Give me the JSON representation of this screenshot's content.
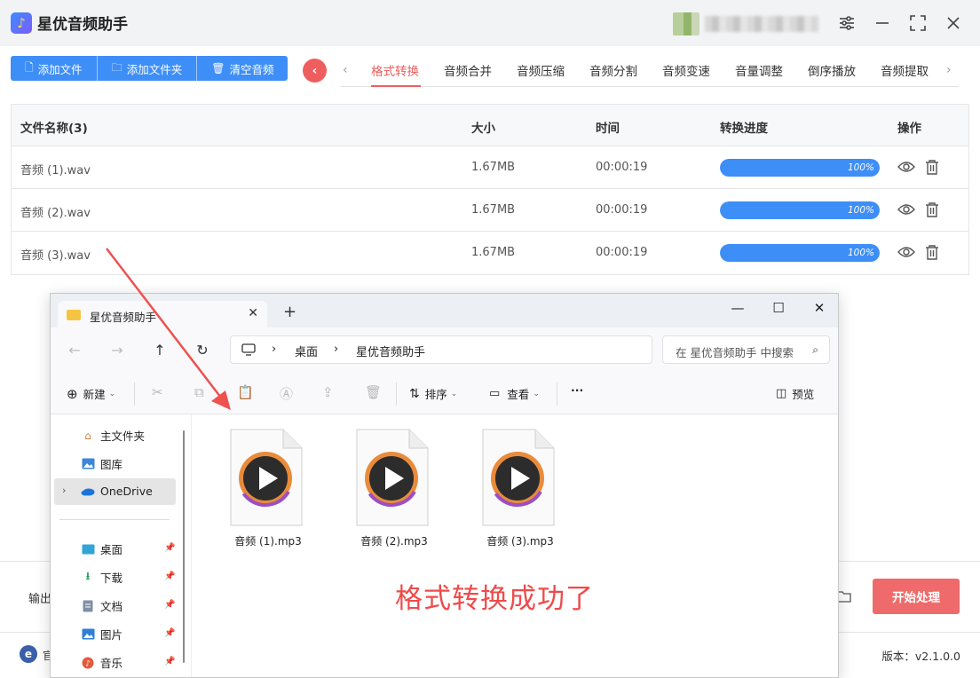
{
  "app": {
    "title": "星优音频助手",
    "logo_icon": "music-note-icon"
  },
  "toolbar": {
    "add_file": "添加文件",
    "add_folder": "添加文件夹",
    "clear_audio": "清空音频"
  },
  "tabs": [
    {
      "label": "格式转换",
      "active": true
    },
    {
      "label": "音频合并"
    },
    {
      "label": "音频压缩"
    },
    {
      "label": "音频分割"
    },
    {
      "label": "音频变速"
    },
    {
      "label": "音量调整"
    },
    {
      "label": "倒序播放"
    },
    {
      "label": "音频提取"
    }
  ],
  "table": {
    "headers": {
      "name": "文件名称(3)",
      "size": "大小",
      "time": "时间",
      "progress": "转换进度",
      "actions": "操作"
    },
    "rows": [
      {
        "name": "音频 (1).wav",
        "size": "1.67MB",
        "time": "00:00:19",
        "progress": 1.0,
        "progress_text": "100%"
      },
      {
        "name": "音频 (2).wav",
        "size": "1.67MB",
        "time": "00:00:19",
        "progress": 1.0,
        "progress_text": "100%"
      },
      {
        "name": "音频 (3).wav",
        "size": "1.67MB",
        "time": "00:00:19",
        "progress": 1.0,
        "progress_text": "100%"
      }
    ]
  },
  "footer": {
    "output_label": "输出",
    "start_button": "开始处理",
    "status_text": "官",
    "status_logo": "e",
    "version": "版本：v2.1.0.0"
  },
  "explorer": {
    "tab_title": "星优音频助手",
    "breadcrumb": [
      "桌面",
      "星优音频助手"
    ],
    "search_placeholder": "在 星优音频助手 中搜索",
    "commands": {
      "new": "新建",
      "sort": "排序",
      "view": "查看",
      "more": "···",
      "preview": "预览"
    },
    "sidebar": [
      {
        "label": "主文件夹",
        "icon": "home-icon"
      },
      {
        "label": "图库",
        "icon": "gallery-icon"
      },
      {
        "label": "OneDrive",
        "icon": "cloud-icon",
        "selected": true
      },
      {
        "label": "桌面",
        "icon": "desktop-icon",
        "pinned": true
      },
      {
        "label": "下载",
        "icon": "download-icon",
        "pinned": true
      },
      {
        "label": "文档",
        "icon": "document-icon",
        "pinned": true
      },
      {
        "label": "图片",
        "icon": "picture-icon",
        "pinned": true
      },
      {
        "label": "音乐",
        "icon": "music-icon",
        "pinned": true
      }
    ],
    "files": [
      {
        "name": "音频 (1).mp3"
      },
      {
        "name": "音频 (2).mp3"
      },
      {
        "name": "音频 (3).mp3"
      }
    ]
  },
  "annotation": {
    "text": "格式转换成功了"
  },
  "colors": {
    "accent_blue": "#3e8ef7",
    "accent_red": "#ef5e5e",
    "annotation_red": "#ee4b4b"
  }
}
